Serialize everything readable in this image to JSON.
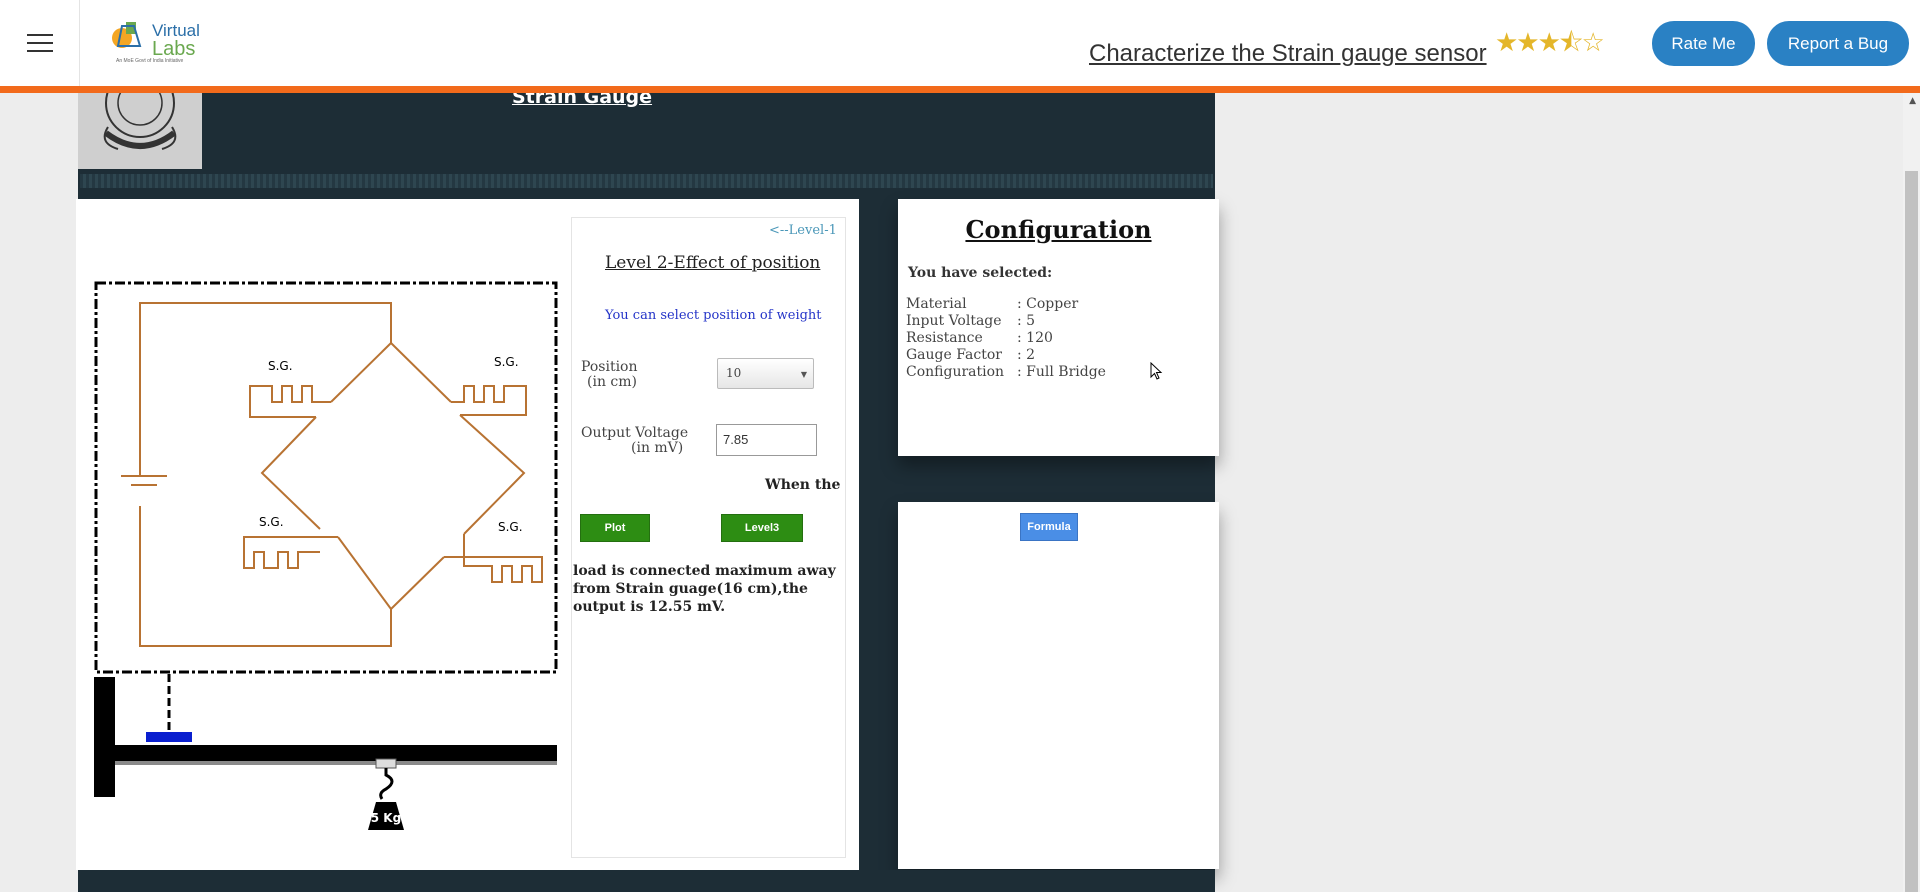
{
  "header": {
    "logo_line1": "Virtual",
    "logo_line2": "Labs",
    "logo_tagline": "An MoE Govt of India Initiative",
    "experiment_title": "Characterize the Strain gauge sensor",
    "rating_stars": "★★★⯪☆",
    "rating_value": 3.5,
    "rate_button": "Rate Me",
    "bug_button": "Report a Bug",
    "accent_color": "#f26a1b",
    "button_color": "#2a81c4"
  },
  "banner": {
    "heading": "Strain Gauge"
  },
  "diagram": {
    "gauge_label": "S.G.",
    "weight_label": "5 Kg"
  },
  "controls": {
    "back_link": "<--Level-1",
    "level_title": "Level 2-Effect of position",
    "select_info": "You can select position of weight",
    "position_label_1": "Position",
    "position_label_2": "(in cm)",
    "position_value": "10",
    "output_label_1": "Output Voltage",
    "output_label_2": "(in mV)",
    "output_value": "7.85",
    "when_text": "When the",
    "plot_button": "Plot",
    "level3_button": "Level3",
    "result_text": "load is connected maximum away from Strain guage(16 cm),the output is 12.55 mV."
  },
  "configuration": {
    "title": "Configuration",
    "selected_label": "You have selected:",
    "rows": [
      {
        "key": "Material",
        "value": ": Copper"
      },
      {
        "key": "Input Voltage",
        "value": ": 5"
      },
      {
        "key": "Resistance",
        "value": ": 120"
      },
      {
        "key": "Gauge Factor",
        "value": ": 2"
      },
      {
        "key": "Configuration",
        "value": ": Full Bridge"
      }
    ]
  },
  "formula_panel": {
    "formula_button": "Formula"
  }
}
